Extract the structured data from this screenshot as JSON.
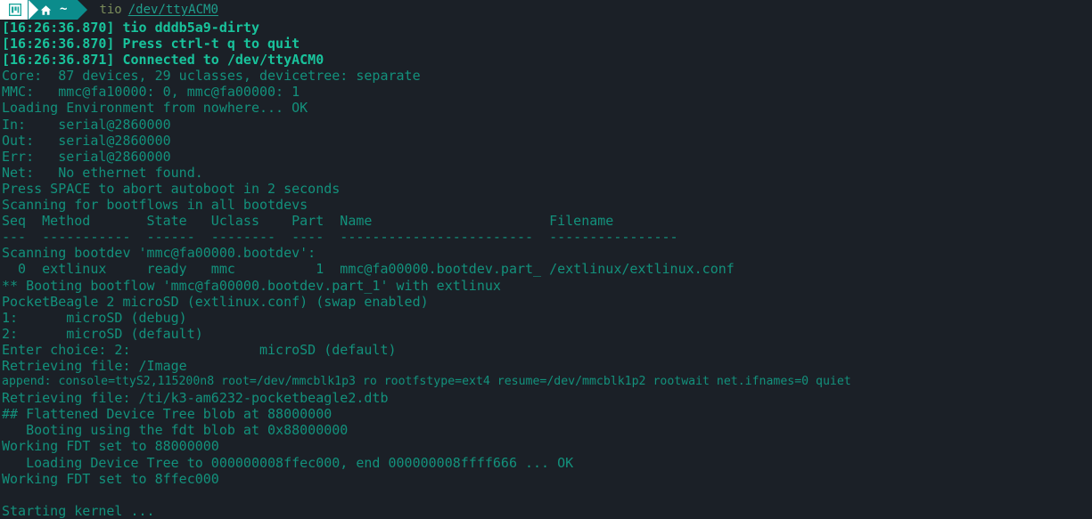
{
  "window": {
    "titlebar": {
      "segments": [
        {
          "name": "terminal-icon-segment",
          "icon": "terminal-window-icon"
        },
        {
          "name": "path-segment",
          "icon": "home-icon",
          "label": "~"
        }
      ],
      "command": "tio",
      "device": "/dev/ttyACM0"
    }
  },
  "colors": {
    "background": "#1b2027",
    "text_normal": "#13917c",
    "text_bold": "#19c39c",
    "powerline_teal": "#0b8c8c",
    "powerline_white": "#ffffff",
    "title_command": "#7a8c5a",
    "title_device": "#1f9e8c"
  },
  "terminal": {
    "lines": [
      {
        "text": "[16:26:36.870] tio dddb5a9-dirty",
        "bold": true
      },
      {
        "text": "[16:26:36.870] Press ctrl-t q to quit",
        "bold": true
      },
      {
        "text": "[16:26:36.871] Connected to /dev/ttyACM0",
        "bold": true
      },
      {
        "text": "Core:  87 devices, 29 uclasses, devicetree: separate",
        "bold": false
      },
      {
        "text": "MMC:   mmc@fa10000: 0, mmc@fa00000: 1",
        "bold": false
      },
      {
        "text": "Loading Environment from nowhere... OK",
        "bold": false
      },
      {
        "text": "In:    serial@2860000",
        "bold": false
      },
      {
        "text": "Out:   serial@2860000",
        "bold": false
      },
      {
        "text": "Err:   serial@2860000",
        "bold": false
      },
      {
        "text": "Net:   No ethernet found.",
        "bold": false
      },
      {
        "text": "Press SPACE to abort autoboot in 2 seconds",
        "bold": false
      },
      {
        "text": "Scanning for bootflows in all bootdevs",
        "bold": false
      },
      {
        "text": "Seq  Method       State   Uclass    Part  Name                      Filename",
        "bold": false
      },
      {
        "text": "---  -----------  ------  --------  ----  ------------------------  ----------------",
        "bold": false
      },
      {
        "text": "Scanning bootdev 'mmc@fa00000.bootdev':",
        "bold": false
      },
      {
        "text": "  0  extlinux     ready   mmc          1  mmc@fa00000.bootdev.part_ /extlinux/extlinux.conf",
        "bold": false
      },
      {
        "text": "** Booting bootflow 'mmc@fa00000.bootdev.part_1' with extlinux",
        "bold": false
      },
      {
        "text": "PocketBeagle 2 microSD (extlinux.conf) (swap enabled)",
        "bold": false
      },
      {
        "text": "1:\tmicroSD (debug)",
        "bold": false
      },
      {
        "text": "2:\tmicroSD (default)",
        "bold": false
      },
      {
        "text": "Enter choice: 2:\t\tmicroSD (default)",
        "bold": false
      },
      {
        "text": "Retrieving file: /Image",
        "bold": false
      },
      {
        "text": "append: console=ttyS2,115200n8 root=/dev/mmcblk1p3 ro rootfstype=ext4 resume=/dev/mmcblk1p2 rootwait net.ifnames=0 quiet",
        "bold": false,
        "small": true
      },
      {
        "text": "Retrieving file: /ti/k3-am6232-pocketbeagle2.dtb",
        "bold": false
      },
      {
        "text": "## Flattened Device Tree blob at 88000000",
        "bold": false
      },
      {
        "text": "   Booting using the fdt blob at 0x88000000",
        "bold": false
      },
      {
        "text": "Working FDT set to 88000000",
        "bold": false
      },
      {
        "text": "   Loading Device Tree to 000000008ffec000, end 000000008ffff666 ... OK",
        "bold": false
      },
      {
        "text": "Working FDT set to 8ffec000",
        "bold": false
      },
      {
        "text": "",
        "bold": false
      },
      {
        "text": "Starting kernel ...",
        "bold": false
      }
    ]
  }
}
